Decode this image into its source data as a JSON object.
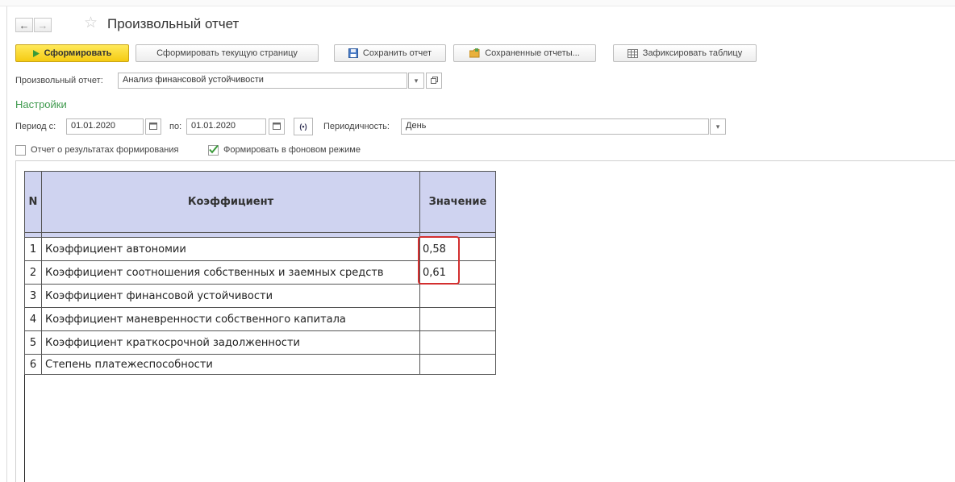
{
  "window": {
    "title": "Произвольный отчет"
  },
  "nav": {
    "back_icon": "arrow-left-icon",
    "forward_icon": "arrow-right-icon",
    "favorite_icon": "star-icon"
  },
  "toolbar": {
    "generate_label": "Сформировать",
    "generate_page_label": "Сформировать текущую страницу",
    "save_label": "Сохранить отчет",
    "saved_reports_label": "Сохраненные отчеты...",
    "fix_table_label": "Зафиксировать таблицу"
  },
  "report_select": {
    "label": "Произвольный отчет:",
    "value": "Анализ финансовой устойчивости"
  },
  "settings": {
    "heading": "Настройки",
    "period_from_label": "Период с:",
    "period_from": "01.01.2020",
    "period_to_label": "по:",
    "period_to": "01.01.2020",
    "periodicity_label": "Периодичность:",
    "periodicity": "День",
    "report_results_label": "Отчет о результатах формирования",
    "report_results_checked": false,
    "background_label": "Формировать в фоновом режиме",
    "background_checked": true
  },
  "table": {
    "headers": {
      "n": "N",
      "coef": "Коэффициент",
      "value": "Значение"
    },
    "rows": [
      {
        "n": "1",
        "name": "Коэффициент автономии",
        "value": "0,58"
      },
      {
        "n": "2",
        "name": "Коэффициент соотношения собственных и заемных средств",
        "value": "0,61"
      },
      {
        "n": "3",
        "name": "Коэффициент финансовой устойчивости",
        "value": ""
      },
      {
        "n": "4",
        "name": "Коэффициент маневренности собственного капитала",
        "value": ""
      },
      {
        "n": "5",
        "name": "Коэффициент краткосрочной задолженности",
        "value": ""
      },
      {
        "n": "6",
        "name": "Степень платежеспособности",
        "value": ""
      }
    ]
  },
  "colors": {
    "primary_button": "#f5cb12",
    "settings_heading": "#3f9a4e",
    "table_header": "#cfd3f0",
    "highlight": "#d32f2f"
  }
}
